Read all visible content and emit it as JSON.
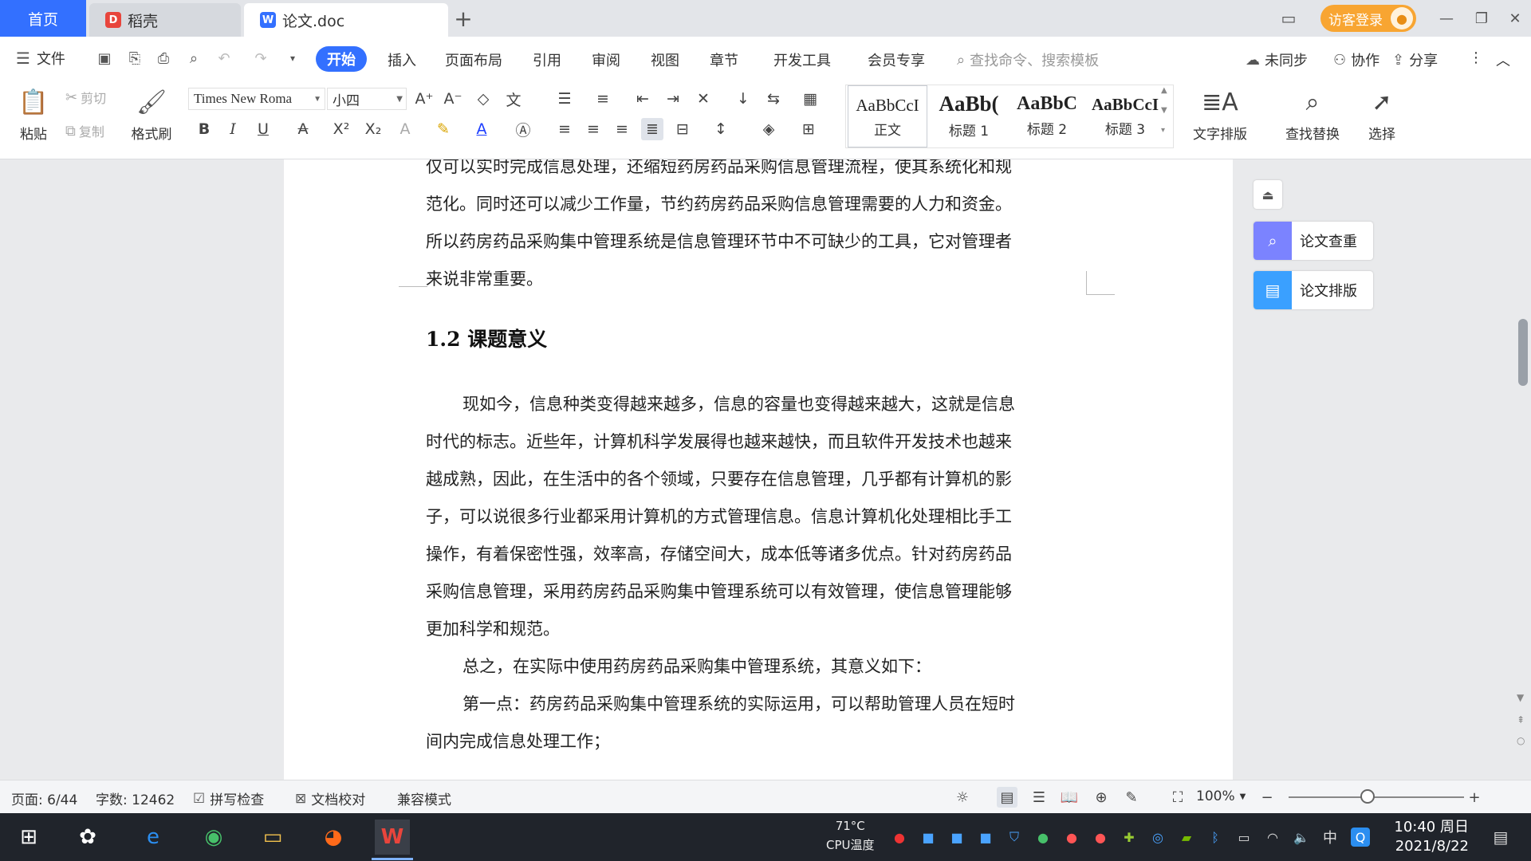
{
  "tabs": {
    "home": "首页",
    "tab1": "稻壳",
    "tab2": "论文.doc"
  },
  "titlebar": {
    "guest_login": "访客登录"
  },
  "menu": {
    "file": "文件",
    "items": [
      "开始",
      "插入",
      "页面布局",
      "引用",
      "审阅",
      "视图",
      "章节",
      "开发工具",
      "会员专享"
    ],
    "search_placeholder": "查找命令、搜索模板",
    "sync": "未同步",
    "collab": "协作",
    "share": "分享"
  },
  "ribbon": {
    "paste": "粘贴",
    "cut": "剪切",
    "copy": "复制",
    "format_painter": "格式刷",
    "font_name": "Times New Roma",
    "font_size": "小四",
    "styles": [
      {
        "preview": "AaBbCcI",
        "name": "正文"
      },
      {
        "preview": "AaBb(",
        "name": "标题 1"
      },
      {
        "preview": "AaBbC",
        "name": "标题 2"
      },
      {
        "preview": "AaBbCcI",
        "name": "标题 3"
      }
    ],
    "text_layout": "文字排版",
    "find_replace": "查找替换",
    "select": "选择"
  },
  "document": {
    "para0": [
      "仅可以实时完成信息处理，还缩短药房药品采购信息管理流程，使其系统化和规",
      "范化。同时还可以减少工作量，节约药房药品采购信息管理需要的人力和资金。",
      "所以药房药品采购集中管理系统是信息管理环节中不可缺少的工具，它对管理者",
      "来说非常重要。"
    ],
    "heading": "1.2  课题意义",
    "para1": [
      "现如今，信息种类变得越来越多，信息的容量也变得越来越大，这就是信息",
      "时代的标志。近些年，计算机科学发展得也越来越快，而且软件开发技术也越来",
      "越成熟，因此，在生活中的各个领域，只要存在信息管理，几乎都有计算机的影",
      "子，可以说很多行业都采用计算机的方式管理信息。信息计算机化处理相比手工",
      "操作，有着保密性强，效率高，存储空间大，成本低等诸多优点。针对药房药品",
      "采购信息管理，采用药房药品采购集中管理系统可以有效管理，使信息管理能够",
      "更加科学和规范。"
    ],
    "para2": [
      "总之，在实际中使用药房药品采购集中管理系统，其意义如下："
    ],
    "para3": [
      "第一点：药房药品采购集中管理系统的实际运用，可以帮助管理人员在短时",
      "间内完成信息处理工作；"
    ]
  },
  "side_panel": {
    "check": "论文查重",
    "layout": "论文排版"
  },
  "status": {
    "page": "页面: 6/44",
    "words": "字数: 12462",
    "spell": "拼写检查",
    "proof": "文档校对",
    "compat": "兼容模式",
    "zoom": "100%"
  },
  "taskbar": {
    "temp": "71°C",
    "cpu": "CPU温度",
    "ime": "中",
    "time": "10:40 周日",
    "date": "2021/8/22"
  },
  "colors": {
    "accent": "#3370ff",
    "guest": "#f8a532",
    "check_icon": "#7b83ff",
    "layout_icon": "#3aa0ff"
  }
}
